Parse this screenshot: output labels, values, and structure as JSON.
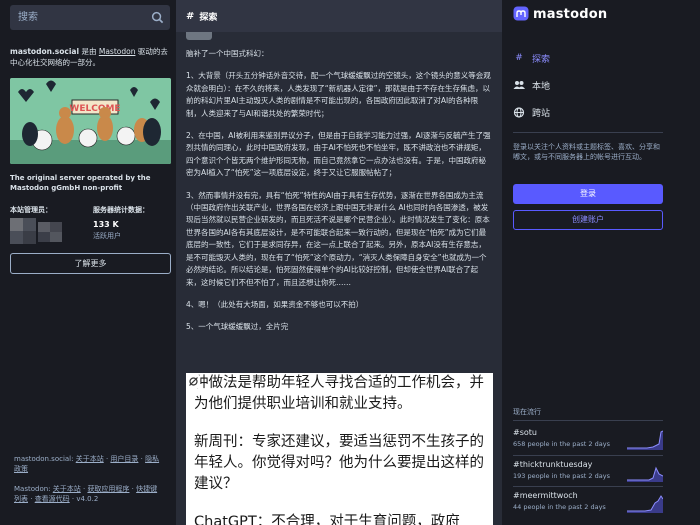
{
  "search": {
    "placeholder": "搜索"
  },
  "server": {
    "name": "mastodon.social",
    "desc_mid": " 是由 ",
    "link": "Mastodon",
    "desc_end": " 驱动的去中心化社交网络的一部分。",
    "operator_title": "The original server operated by the Mastodon gGmbH non-profit",
    "admin_label": "本站管理员：",
    "stats_label": "服务器统计数据：",
    "active_count": "133 K",
    "active_label": "活跃用户",
    "learn_more": "了解更多"
  },
  "footer": {
    "line1_prefix": "mastodon.social: ",
    "line1_links": [
      "关于本站",
      "用户目录",
      "隐私政策"
    ],
    "line2_prefix": "Mastodon: ",
    "line2_links": [
      "关于本站",
      "获取应用程序",
      "快捷键列表",
      "查看源代码"
    ],
    "version": " · v4.0.2"
  },
  "main": {
    "header": "探索",
    "post": [
      "脑补了一个中国式科幻：",
      "1、大背景（开头五分钟话外音交待，配一个气球缓缓飘过的空镜头，这个镜头的意义等会观众就会明白）：在不久的将来，人类发现了“新机器人定律”，那就是由于不存在生存焦虑，以前的科幻片里AI主动毁灭人类的剧情是不可能出现的，各国政府因此取消了对AI的各种限制，人类迎来了与AI和谐共处的繁荣时代；",
      "2、在中国，AI被利用来鉴别异议分子，但是由于自我学习能力过强，AI逐渐与反毓产生了强烈共情的同理心，此时中国政府发现，由于AI不怕死也不怕坐牢，既不讲政治也不讲规矩，四个意识个个皆无两个维护形同无物，而自己竟然拿它一点办法也没有。于是，中国政府秘密为AI植入了“怕死”这一项底层设定，终于又让它服服帖帖了；",
      "3、然而事情并没有完，具有“怕死”特性的AI由于具有生存优势，逐渐在世界各国成为主流（中国政府作出关联产业，世界各国在经济上跟中国无非是什么 AI也同时向各国渗透，被发现后当然就以民营企业研发的，而且死活不说是哪个民营企业）。此时情况发生了变化：原本世界各国的AI各有其底层设计，是不可能联合起来一致行动的，但是现在“怕死”成为它们最底层的一致性，它们于是求同存异，在这一点上联合了起来。另外，原本AI没有生存意志，是不可能毁灭人类的，现在有了“怕死”这个原动力，“消灭人类保障自身安全”也就成为一个必然的结论。所以结论是，怕死固然使得单个的AI比较好控制，但却使全世界AI联合了起来，这时候它们不但不怕了，而且还想让你死……",
      "4、嗯！（此处有大场面，如果资金不够也可以不拍）",
      "5、一个气球缓缓飘过，全片完"
    ],
    "image_text": [
      "种做法是帮助年轻人寻找合适的工作机会，并为他们提供职业培训和就业支持。",
      "新周刊：专家还建议，要适当惩罚不生孩子的年轻人。你觉得对吗？他为什么要提出这样的建议？",
      "ChatGPT：不合理，对于生育问题，政府"
    ]
  },
  "right": {
    "brand": "mastodon",
    "nav": [
      {
        "icon": "#",
        "label": "探索"
      },
      {
        "icon": "users",
        "label": "本地"
      },
      {
        "icon": "globe",
        "label": "跨站"
      }
    ],
    "signup_text": "登录以关注个人资料或主题标签、喜欢、分享和嘟文，或与不同服务器上的帐号进行互动。",
    "login": "登录",
    "register": "创建账户",
    "trending_title": "现在流行",
    "trends": [
      {
        "tag": "#sotu",
        "count": "658 people in the past 2 days"
      },
      {
        "tag": "#thicktrunktuesday",
        "count": "193 people in the past 2 days"
      },
      {
        "tag": "#meermittwoch",
        "count": "44 people in the past 2 days"
      }
    ]
  },
  "colors": {
    "accent": "#595aff",
    "accent_text": "#8c8dff",
    "bg": "#191b22",
    "panel": "#282c37"
  }
}
